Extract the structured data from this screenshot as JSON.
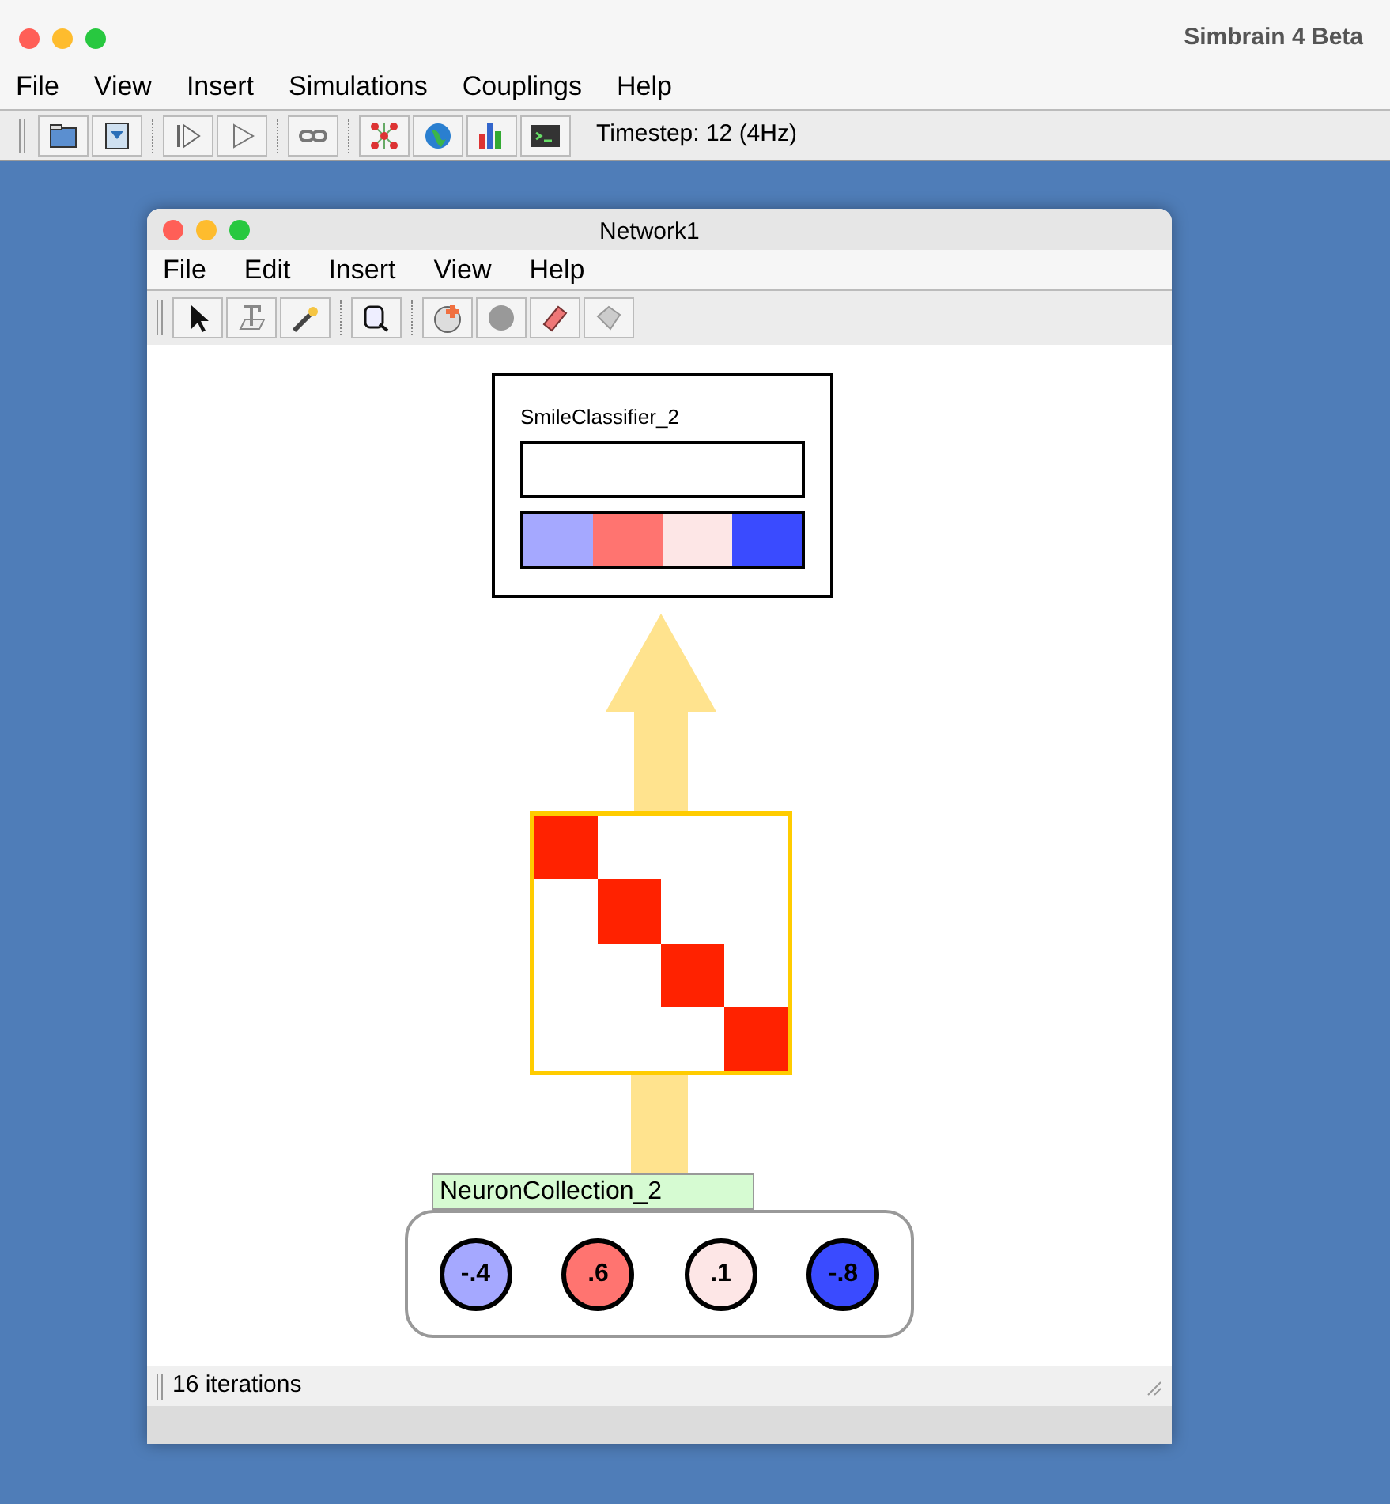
{
  "window": {
    "title": "Simbrain 4 Beta"
  },
  "menu": [
    "File",
    "View",
    "Insert",
    "Simulations",
    "Couplings",
    "Help"
  ],
  "toolbar": {
    "timestep": "Timestep: 12 (4Hz)"
  },
  "network_window": {
    "title": "Network1",
    "menu": [
      "File",
      "Edit",
      "Insert",
      "View",
      "Help"
    ],
    "classifier": {
      "label": "SmileClassifier_2",
      "cells": [
        {
          "color": "#a5a8ff"
        },
        {
          "color": "#ff7470"
        },
        {
          "color": "#fde6e6"
        },
        {
          "color": "#3a4bff"
        }
      ]
    },
    "collection": {
      "label": "NeuronCollection_2",
      "neurons": [
        {
          "value": "-.4",
          "color": "#a5a8ff"
        },
        {
          "value": ".6",
          "color": "#ff7470"
        },
        {
          "value": ".1",
          "color": "#fde6e6"
        },
        {
          "value": "-.8",
          "color": "#3a4bff"
        }
      ]
    },
    "status": "16 iterations"
  }
}
